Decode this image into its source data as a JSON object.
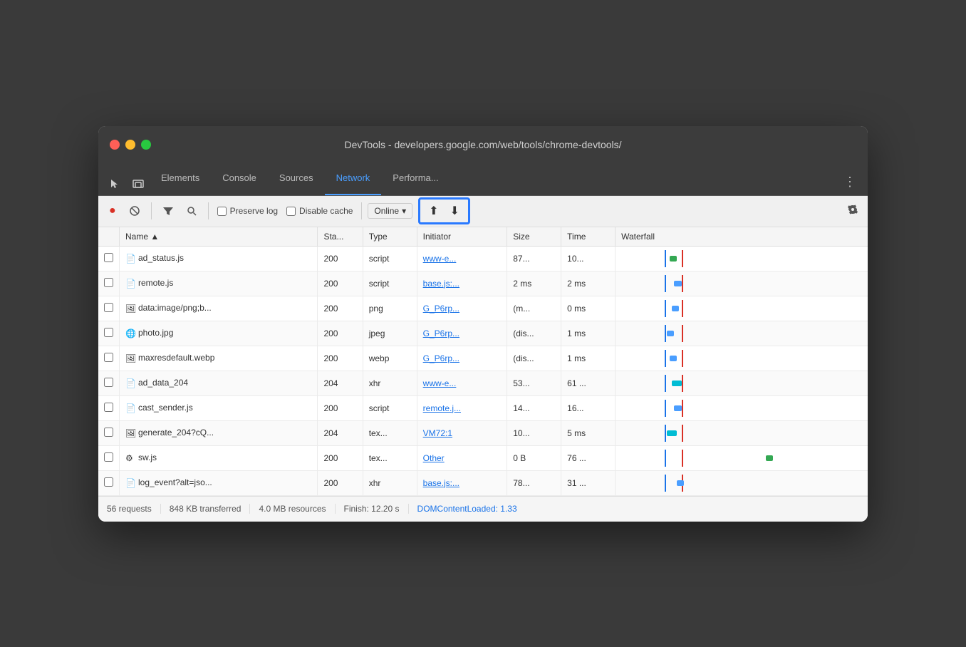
{
  "window": {
    "title": "DevTools - developers.google.com/web/tools/chrome-devtools/"
  },
  "tabs": [
    {
      "id": "elements",
      "label": "Elements",
      "active": false
    },
    {
      "id": "console",
      "label": "Console",
      "active": false
    },
    {
      "id": "sources",
      "label": "Sources",
      "active": false
    },
    {
      "id": "network",
      "label": "Network",
      "active": true
    },
    {
      "id": "performance",
      "label": "Performa...",
      "active": false
    }
  ],
  "toolbar": {
    "preserve_log": "Preserve log",
    "disable_cache": "Disable cache",
    "online": "Online",
    "upload_icon": "⬆",
    "download_icon": "⬇"
  },
  "table": {
    "headers": [
      "",
      "Name",
      "Sta...",
      "Type",
      "Initiator",
      "Size",
      "Time",
      "Waterfall"
    ],
    "rows": [
      {
        "name": "ad_status.js",
        "status": "200",
        "type": "script",
        "initiator": "www-e...",
        "size": "87...",
        "time": "10...",
        "icon": "doc"
      },
      {
        "name": "remote.js",
        "status": "200",
        "type": "script",
        "initiator": "base.js:...",
        "size": "2 ms",
        "time": "2 ms",
        "icon": "doc"
      },
      {
        "name": "data:image/png;b...",
        "status": "200",
        "type": "png",
        "initiator": "G_P6rp...",
        "size": "(m...",
        "time": "0 ms",
        "icon": "img"
      },
      {
        "name": "photo.jpg",
        "status": "200",
        "type": "jpeg",
        "initiator": "G_P6rp...",
        "size": "(dis...",
        "time": "1 ms",
        "icon": "chrome"
      },
      {
        "name": "maxresdefault.webp",
        "status": "200",
        "type": "webp",
        "initiator": "G_P6rp...",
        "size": "(dis...",
        "time": "1 ms",
        "icon": "img"
      },
      {
        "name": "ad_data_204",
        "status": "204",
        "type": "xhr",
        "initiator": "www-e...",
        "size": "53...",
        "time": "61 ...",
        "icon": "doc"
      },
      {
        "name": "cast_sender.js",
        "status": "200",
        "type": "script",
        "initiator": "remote.j...",
        "size": "14...",
        "time": "16...",
        "icon": "doc"
      },
      {
        "name": "generate_204?cQ...",
        "status": "204",
        "type": "tex...",
        "initiator": "VM72:1",
        "size": "10...",
        "time": "5 ms",
        "icon": "img"
      },
      {
        "name": "sw.js",
        "status": "200",
        "type": "tex...",
        "initiator": "Other",
        "size": "0 B",
        "time": "76 ...",
        "icon": "gear"
      },
      {
        "name": "log_event?alt=jso...",
        "status": "200",
        "type": "xhr",
        "initiator": "base.js:...",
        "size": "78...",
        "time": "31 ...",
        "icon": "doc"
      }
    ]
  },
  "status_bar": {
    "requests": "56 requests",
    "transferred": "848 KB transferred",
    "resources": "4.0 MB resources",
    "finish": "Finish: 12.20 s",
    "dom_content": "DOMContentLoaded: 1.33"
  }
}
